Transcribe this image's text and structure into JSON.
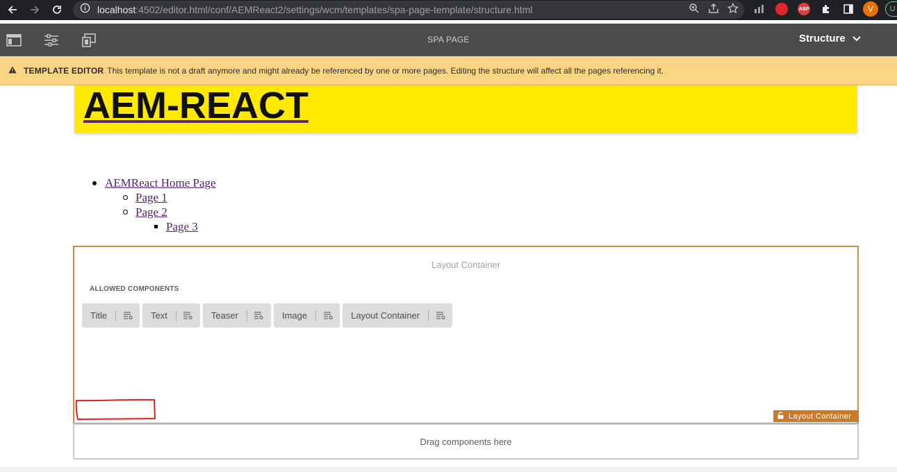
{
  "browser": {
    "url_host": "localhost",
    "url_path": ":4502/editor.html/conf/AEMReact2/settings/wcm/templates/spa-page-template/structure.html",
    "profile_initial": "V",
    "profile_chip_text": "U",
    "abp_label": "ABP"
  },
  "editor": {
    "page_name": "SPA PAGE",
    "mode": "Structure"
  },
  "alert": {
    "title": "TEMPLATE EDITOR",
    "message": "This template is not a draft anymore and might already be referenced by one or more pages. Editing the structure will affect all the pages referencing it."
  },
  "page": {
    "hero_title": "AEM-REACT",
    "nav": [
      {
        "label": "AEMReact Home Page",
        "level": 1
      },
      {
        "label": "Page 1",
        "level": 2
      },
      {
        "label": "Page 2",
        "level": 2
      },
      {
        "label": "Page 3",
        "level": 3
      }
    ]
  },
  "layout_container": {
    "placeholder": "Layout Container",
    "allowed_label": "ALLOWED COMPONENTS",
    "components": [
      "Title",
      "Text",
      "Teaser",
      "Image",
      "Layout Container"
    ],
    "badge_label": "Layout Container"
  },
  "drop_zone": {
    "text": "Drag components here"
  },
  "colors": {
    "alert_bg": "#fad583",
    "hero_bg": "#ffe900",
    "container_border": "#cb8d3f",
    "badge_bg": "#cb7a2a",
    "link": "#50246b"
  }
}
